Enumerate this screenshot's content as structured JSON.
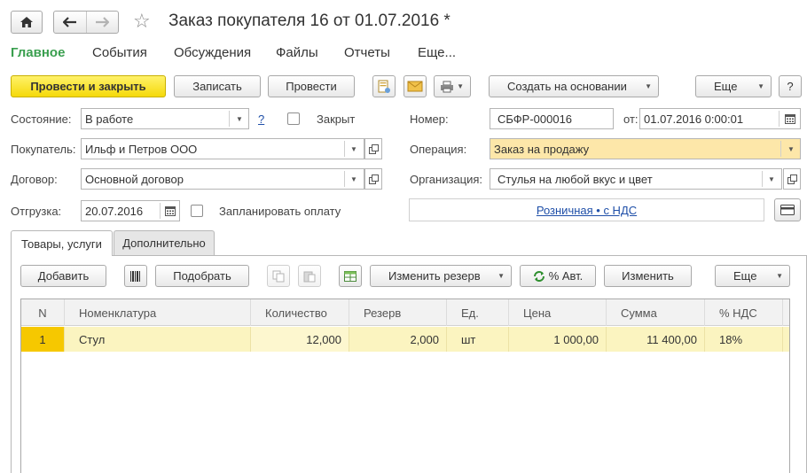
{
  "window": {
    "title": "Заказ покупателя 16 от 01.07.2016 *",
    "icons": {
      "home": "home-icon",
      "back": "arrow-left-icon",
      "forward": "arrow-right-icon",
      "favorite": "star-icon"
    }
  },
  "menu": {
    "items": [
      {
        "label": "Главное",
        "active": true
      },
      {
        "label": "События"
      },
      {
        "label": "Обсуждения"
      },
      {
        "label": "Файлы"
      },
      {
        "label": "Отчеты"
      },
      {
        "label": "Еще..."
      }
    ]
  },
  "toolbar": {
    "post_close": "Провести и закрыть",
    "save": "Записать",
    "post": "Провести",
    "create_based": "Создать на основании",
    "more": "Еще",
    "help": "?"
  },
  "form": {
    "state_label": "Состояние:",
    "state_value": "В работе",
    "state_help": "?",
    "closed_label": "Закрыт",
    "number_label": "Номер:",
    "number_value": "СБФР-000016",
    "date_label": "от:",
    "date_value": "01.07.2016  0:00:01",
    "buyer_label": "Покупатель:",
    "buyer_value": "Ильф и Петров ООО",
    "operation_label": "Операция:",
    "operation_value": "Заказ на продажу",
    "contract_label": "Договор:",
    "contract_value": "Основной договор",
    "org_label": "Организация:",
    "org_value": "Стулья на любой вкус и цвет",
    "shipment_label": "Отгрузка:",
    "shipment_value": "20.07.2016",
    "plan_payment_label": "Запланировать оплату",
    "price_type_link": "Розничная • с НДС"
  },
  "tabs": [
    {
      "label": "Товары, услуги",
      "active": true
    },
    {
      "label": "Дополнительно",
      "active": false
    }
  ],
  "table_toolbar": {
    "add": "Добавить",
    "pick": "Подобрать",
    "change_reserve": "Изменить резерв",
    "auto_pct": "% Авт.",
    "change": "Изменить",
    "more": "Еще"
  },
  "table": {
    "columns": [
      "N",
      "Номенклатура",
      "Количество",
      "Резерв",
      "Ед.",
      "Цена",
      "Сумма",
      "% НДС"
    ],
    "rows": [
      {
        "n": "1",
        "item": "Стул",
        "qty": "12,000",
        "reserve": "2,000",
        "unit": "шт",
        "price": "1 000,00",
        "sum": "11 400,00",
        "vat": "18%"
      }
    ]
  },
  "colors": {
    "primary_button": "#f5d90a",
    "active_menu": "#3a9f4f",
    "highlight_field": "#fde7a9",
    "selected_row": "#fbf4c0",
    "link": "#1f4fa8"
  }
}
